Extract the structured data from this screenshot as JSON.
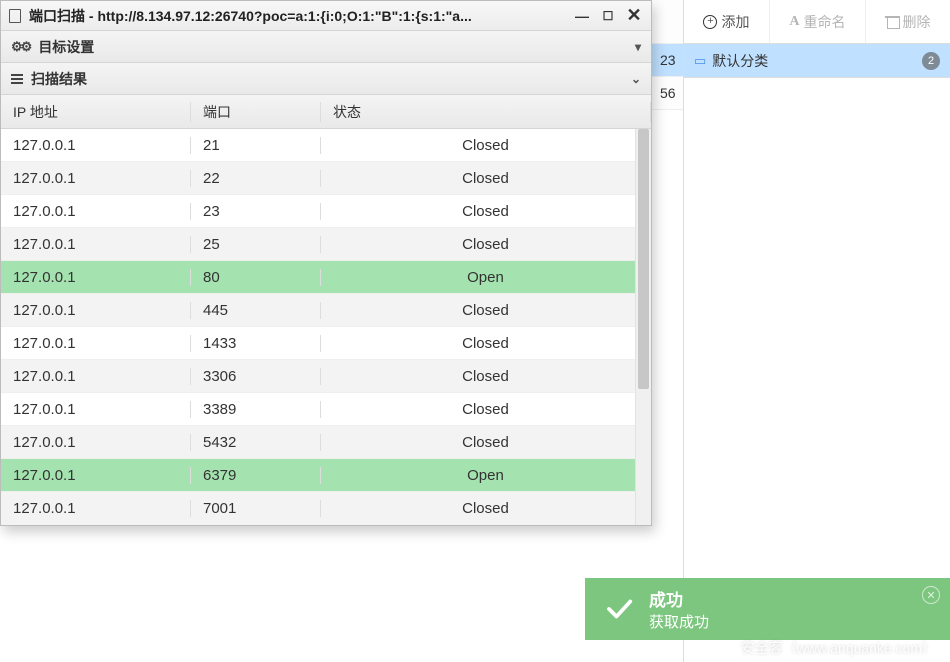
{
  "dialog": {
    "title": "端口扫描 - http://8.134.97.12:26740?poc=a:1:{i:0;O:1:\"B\":1:{s:1:\"a...",
    "panel_target": "目标设置",
    "panel_results": "扫描结果",
    "columns": {
      "ip": "IP 地址",
      "port": "端口",
      "status": "状态"
    },
    "rows": [
      {
        "ip": "127.0.0.1",
        "port": "21",
        "status": "Closed",
        "open": false
      },
      {
        "ip": "127.0.0.1",
        "port": "22",
        "status": "Closed",
        "open": false
      },
      {
        "ip": "127.0.0.1",
        "port": "23",
        "status": "Closed",
        "open": false
      },
      {
        "ip": "127.0.0.1",
        "port": "25",
        "status": "Closed",
        "open": false
      },
      {
        "ip": "127.0.0.1",
        "port": "80",
        "status": "Open",
        "open": true
      },
      {
        "ip": "127.0.0.1",
        "port": "445",
        "status": "Closed",
        "open": false
      },
      {
        "ip": "127.0.0.1",
        "port": "1433",
        "status": "Closed",
        "open": false
      },
      {
        "ip": "127.0.0.1",
        "port": "3306",
        "status": "Closed",
        "open": false
      },
      {
        "ip": "127.0.0.1",
        "port": "3389",
        "status": "Closed",
        "open": false
      },
      {
        "ip": "127.0.0.1",
        "port": "5432",
        "status": "Closed",
        "open": false
      },
      {
        "ip": "127.0.0.1",
        "port": "6379",
        "status": "Open",
        "open": true
      },
      {
        "ip": "127.0.0.1",
        "port": "7001",
        "status": "Closed",
        "open": false
      }
    ]
  },
  "right": {
    "add": "添加",
    "rename": "重命名",
    "delete": "删除",
    "folder": {
      "name": "默认分类",
      "count": "2"
    }
  },
  "bg": {
    "rowA": "23",
    "rowB": "56"
  },
  "toast": {
    "title": "成功",
    "body": "获取成功"
  },
  "watermark": "安全客（www.anquanke.com）"
}
